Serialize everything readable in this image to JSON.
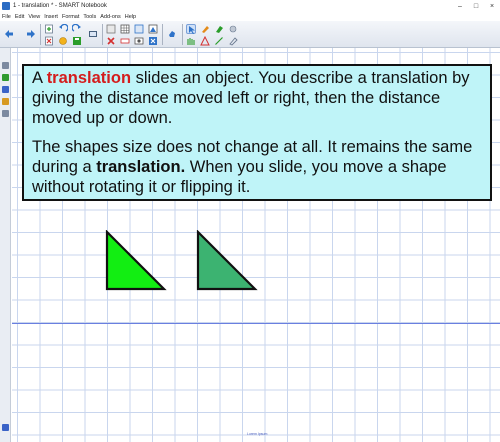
{
  "window": {
    "title": "1 - translation * - SMART Notebook",
    "controls": [
      "–",
      "□",
      "×"
    ]
  },
  "menu": {
    "items": [
      "File",
      "Edit",
      "View",
      "Insert",
      "Format",
      "Tools",
      "Add-ons",
      "Help"
    ]
  },
  "toolbar": {
    "icons": [
      "back-arrow-icon",
      "forward-arrow-icon",
      "add-page-icon",
      "delete-page-icon",
      "undo-icon",
      "redo-icon",
      "open-icon",
      "save-icon",
      "paste-icon",
      "screen-shade-icon",
      "table-icon",
      "fullscreen-icon",
      "document-camera-icon",
      "select-icon",
      "pen-icon",
      "highlighter-icon",
      "eraser-icon",
      "shapes-icon",
      "line-icon",
      "text-icon",
      "fill-icon"
    ]
  },
  "lesson": {
    "p1_pre": "A ",
    "p1_keyword": "translation",
    "p1_post": " slides an object. You describe a translation by giving the distance moved left or right, then the distance moved up or down.",
    "p2_pre": "The shapes size does not change at all. It remains the same during a ",
    "p2_keyword": "translation.",
    "p2_post": " When you slide, you move a shape without rotating it or flipping it."
  },
  "shapes": {
    "original_color": "#12ee12",
    "translated_color": "#3cb371"
  },
  "footer": {
    "label": "Lorem Ipsum"
  }
}
